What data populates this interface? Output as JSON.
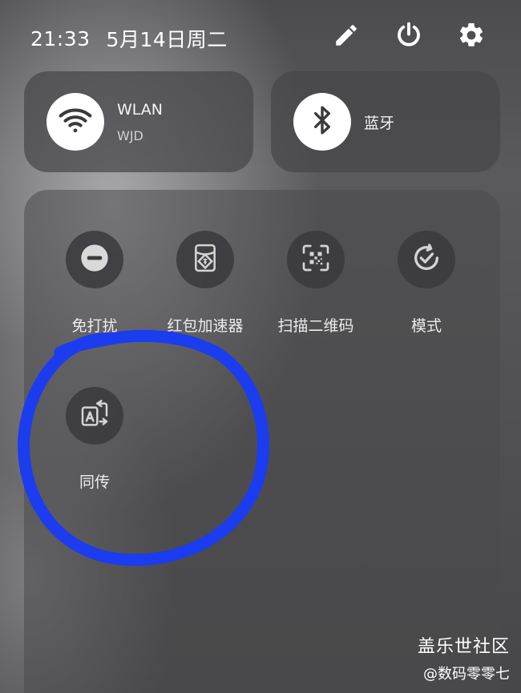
{
  "status_bar": {
    "time": "21:33",
    "date": "5月14日周二"
  },
  "top_actions": [
    {
      "icon": "pencil-icon"
    },
    {
      "icon": "power-icon"
    },
    {
      "icon": "gear-icon"
    }
  ],
  "cards": {
    "wlan": {
      "title": "WLAN",
      "subtitle": "WJD",
      "icon": "wifi-icon",
      "active": true
    },
    "bluetooth": {
      "title": "蓝牙",
      "icon": "bluetooth-icon",
      "active": true
    }
  },
  "tiles": [
    {
      "label": "免打扰",
      "icon": "do-not-disturb-icon"
    },
    {
      "label": "红包加速器",
      "icon": "red-envelope-icon"
    },
    {
      "label": "扫描二维码",
      "icon": "qr-scan-icon"
    },
    {
      "label": "模式",
      "icon": "mode-icon"
    },
    {
      "label": "同传",
      "icon": "translate-icon"
    }
  ],
  "annotation": {
    "color": "#1c3cf0"
  },
  "watermark": {
    "title": "盖乐世社区",
    "subtitle": "@数码零零七"
  }
}
